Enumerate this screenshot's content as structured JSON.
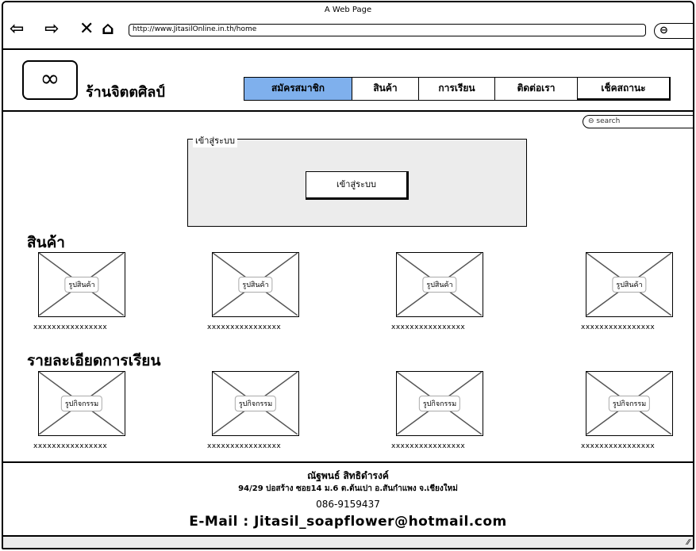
{
  "window": {
    "title": "A Web Page",
    "url": "http://www.JitasilOnline.in.th/home"
  },
  "icons": {
    "back": "back-arrow-icon",
    "forward": "forward-arrow-icon",
    "close": "close-icon",
    "home": "home-icon",
    "search": "search-icon",
    "logo": "infinity-logo-icon"
  },
  "header": {
    "shop_name": "ร้านจิตตศิลป์",
    "nav": [
      "สมัครสมาชิก",
      "สินค้า",
      "การเรียน",
      "ติดต่อเรา",
      "เช็คสถานะ"
    ],
    "active_tab": "สมัครสมาชิก",
    "search_placeholder": "search"
  },
  "login": {
    "legend": "เข้าสู่ระบบ",
    "button": "เข้าสู่ระบบ"
  },
  "products": {
    "title": "สินค้า",
    "items": [
      {
        "image_label": "รูปสินค้า",
        "caption": "xxxxxxxxxxxxxxxx"
      },
      {
        "image_label": "รูปสินค้า",
        "caption": "xxxxxxxxxxxxxxxx"
      },
      {
        "image_label": "รูปสินค้า",
        "caption": "xxxxxxxxxxxxxxxx"
      },
      {
        "image_label": "รูปสินค้า",
        "caption": "xxxxxxxxxxxxxxxx"
      }
    ]
  },
  "classes": {
    "title": "รายละเอียดการเรียน",
    "items": [
      {
        "image_label": "รูปกิจกรรม",
        "caption": "xxxxxxxxxxxxxxxx"
      },
      {
        "image_label": "รูปกิจกรรม",
        "caption": "xxxxxxxxxxxxxxxx"
      },
      {
        "image_label": "รูปกิจกรรม",
        "caption": "xxxxxxxxxxxxxxxx"
      },
      {
        "image_label": "รูปกิจกรรม",
        "caption": "xxxxxxxxxxxxxxxx"
      }
    ]
  },
  "footer": {
    "name": "ณัฐพนธ์ สิทธิดำรงค์",
    "address": "94/29 บ่อสร้าง ซอย14 ม.6 ต.ต้นเปา อ.สันกำแพง จ.เชียงใหม่",
    "phone": "086-9159437",
    "email": "E-Mail : Jitasil_soapflower@hotmail.com"
  },
  "colors": {
    "active_tab": "#7fb0ed",
    "panel_bg": "#ececec"
  }
}
